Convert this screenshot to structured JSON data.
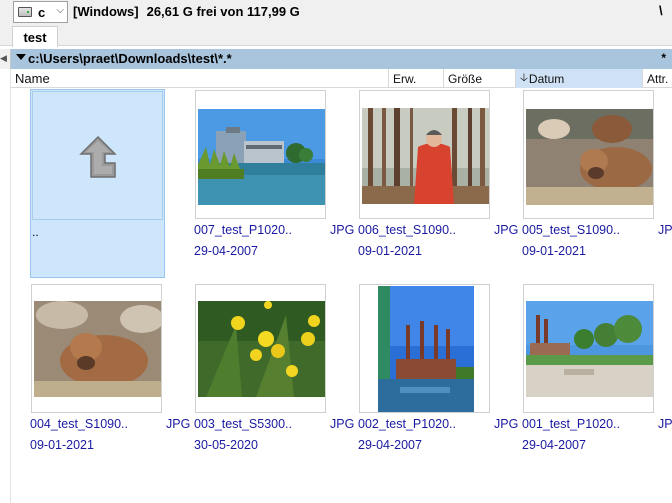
{
  "drive": {
    "letter": "c",
    "label": "[Windows]",
    "free_text": "26,61 G frei von 117,99 G",
    "right_symbol": "\\"
  },
  "tabs": [
    {
      "label": "test"
    }
  ],
  "path": {
    "text": "c:\\Users\\praet\\Downloads\\test\\*.*",
    "star": "*"
  },
  "columns": {
    "name": "Name",
    "ext": "Erw.",
    "size": "Größe",
    "date": "Datum",
    "attr": "Attr."
  },
  "items": [
    {
      "name": "..",
      "ext": "",
      "date": "",
      "type": "parent-folder"
    },
    {
      "name": "007_test_P1020..",
      "ext": "JPG",
      "date": "29-04-2007",
      "type": "image"
    },
    {
      "name": "006_test_S1090..",
      "ext": "JPG",
      "date": "09-01-2021",
      "type": "image"
    },
    {
      "name": "005_test_S1090..",
      "ext": "JPG",
      "date": "09-01-2021",
      "type": "image"
    },
    {
      "name": "004_test_S1090..",
      "ext": "JPG",
      "date": "09-01-2021",
      "type": "image"
    },
    {
      "name": "003_test_S5300..",
      "ext": "JPG",
      "date": "30-05-2020",
      "type": "image"
    },
    {
      "name": "002_test_P1020..",
      "ext": "JPG",
      "date": "29-04-2007",
      "type": "image"
    },
    {
      "name": "001_test_P1020..",
      "ext": "JPG",
      "date": "29-04-2007",
      "type": "image"
    }
  ],
  "colors": {
    "path_bar": "#a9c4dd",
    "selection": "#cde6fb",
    "link_text": "#1a1aa0",
    "sorted_column": "#cfe2f5"
  }
}
